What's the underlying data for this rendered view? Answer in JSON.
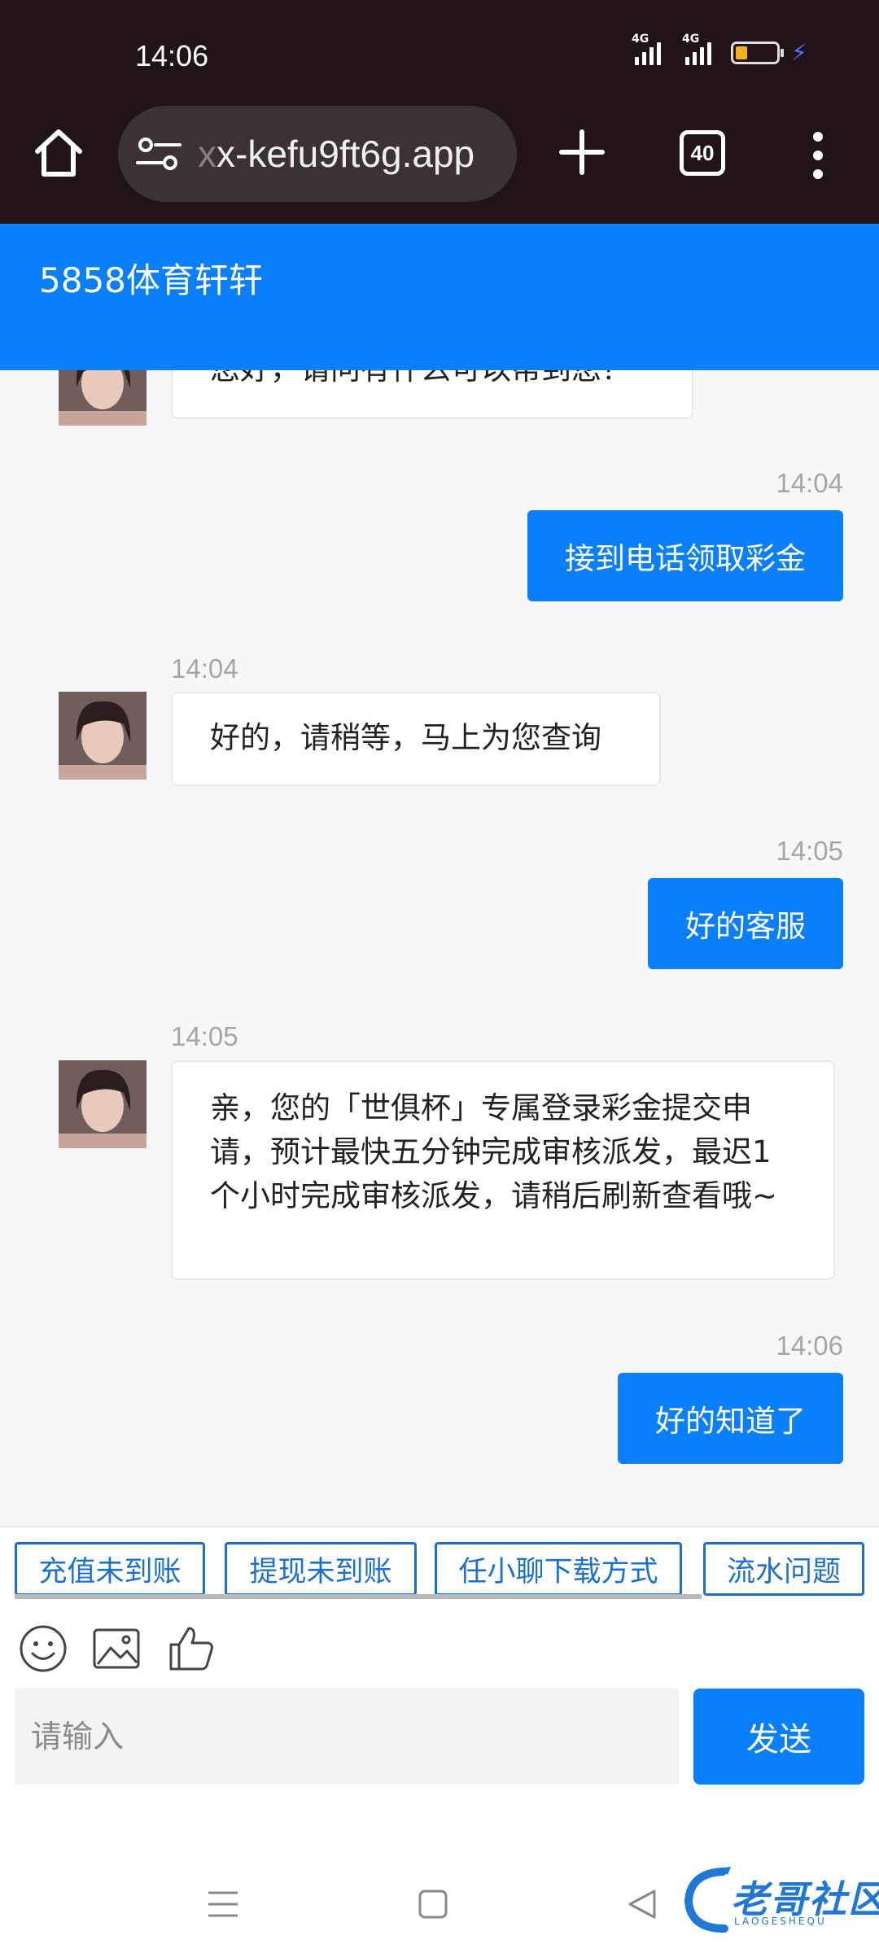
{
  "status_bar": {
    "time": "14:06",
    "network_1": "4G",
    "network_2": "4G"
  },
  "browser": {
    "url_faded": "x",
    "url": "x-kefu9ft6g.app",
    "tab_count": "40"
  },
  "header": {
    "title": "5858体育轩轩"
  },
  "messages": [
    {
      "from": "agent",
      "text": "您好，请问有什么可以帮到您？",
      "time": ""
    },
    {
      "from": "user",
      "text": "接到电话领取彩金",
      "time": "14:04"
    },
    {
      "from": "agent",
      "text": "好的，请稍等，马上为您查询",
      "time": "14:04"
    },
    {
      "from": "user",
      "text": "好的客服",
      "time": "14:05"
    },
    {
      "from": "agent",
      "text": "亲，您的「世俱杯」专属登录彩金提交申请，预计最快五分钟完成审核派发，最迟1个小时完成审核派发，请稍后刷新查看哦~",
      "time": "14:05"
    },
    {
      "from": "user",
      "text": "好的知道了",
      "time": "14:06"
    }
  ],
  "quick_replies": [
    "充值未到账",
    "提现未到账",
    "任小聊下载方式",
    "流水问题"
  ],
  "composer": {
    "placeholder": "请输入",
    "send_label": "发送"
  },
  "watermark": {
    "text": "老哥社区",
    "sub": "LAOGESHEQU"
  },
  "colors": {
    "accent": "#0a7ffb",
    "browser_bg": "#201419",
    "chat_bg": "#f7f7f9"
  }
}
